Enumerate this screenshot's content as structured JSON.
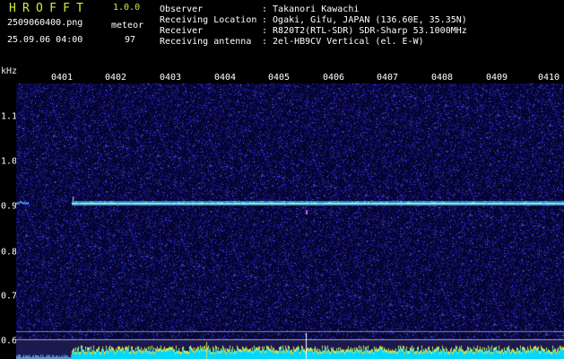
{
  "app": {
    "name": "HROFFT",
    "version": "1.0.0"
  },
  "file": {
    "name": "2509060400.png",
    "datetime": "25.09.06 04:00"
  },
  "meteor": {
    "label": "meteor",
    "count": "97"
  },
  "info": [
    {
      "key": "Observer",
      "value": ": Takanori Kawachi"
    },
    {
      "key": "Receiving Location",
      "value": ": Ogaki, Gifu, JAPAN (136.60E, 35.35N)"
    },
    {
      "key": "Receiver",
      "value": ": R820T2(RTL-SDR) SDR-Sharp 53.1000MHz"
    },
    {
      "key": "Receiving antenna",
      "value": ": 2el-HB9CV Vertical (el. E-W)"
    }
  ],
  "axes": {
    "y_unit": "kHz",
    "x_ticks": [
      "0401",
      "0402",
      "0403",
      "0404",
      "0405",
      "0406",
      "0407",
      "0408",
      "0409",
      "0410"
    ],
    "y_ticks": [
      "1.1",
      "1.0",
      "0.9",
      "0.8",
      "0.7",
      "0.6"
    ]
  },
  "colors": {
    "title": "#d8e840",
    "text": "#ffffff",
    "background": "#000000",
    "signal_line": "#f0f090",
    "noise": "#2a2ad0",
    "level_bars": "#00d8ff"
  }
}
